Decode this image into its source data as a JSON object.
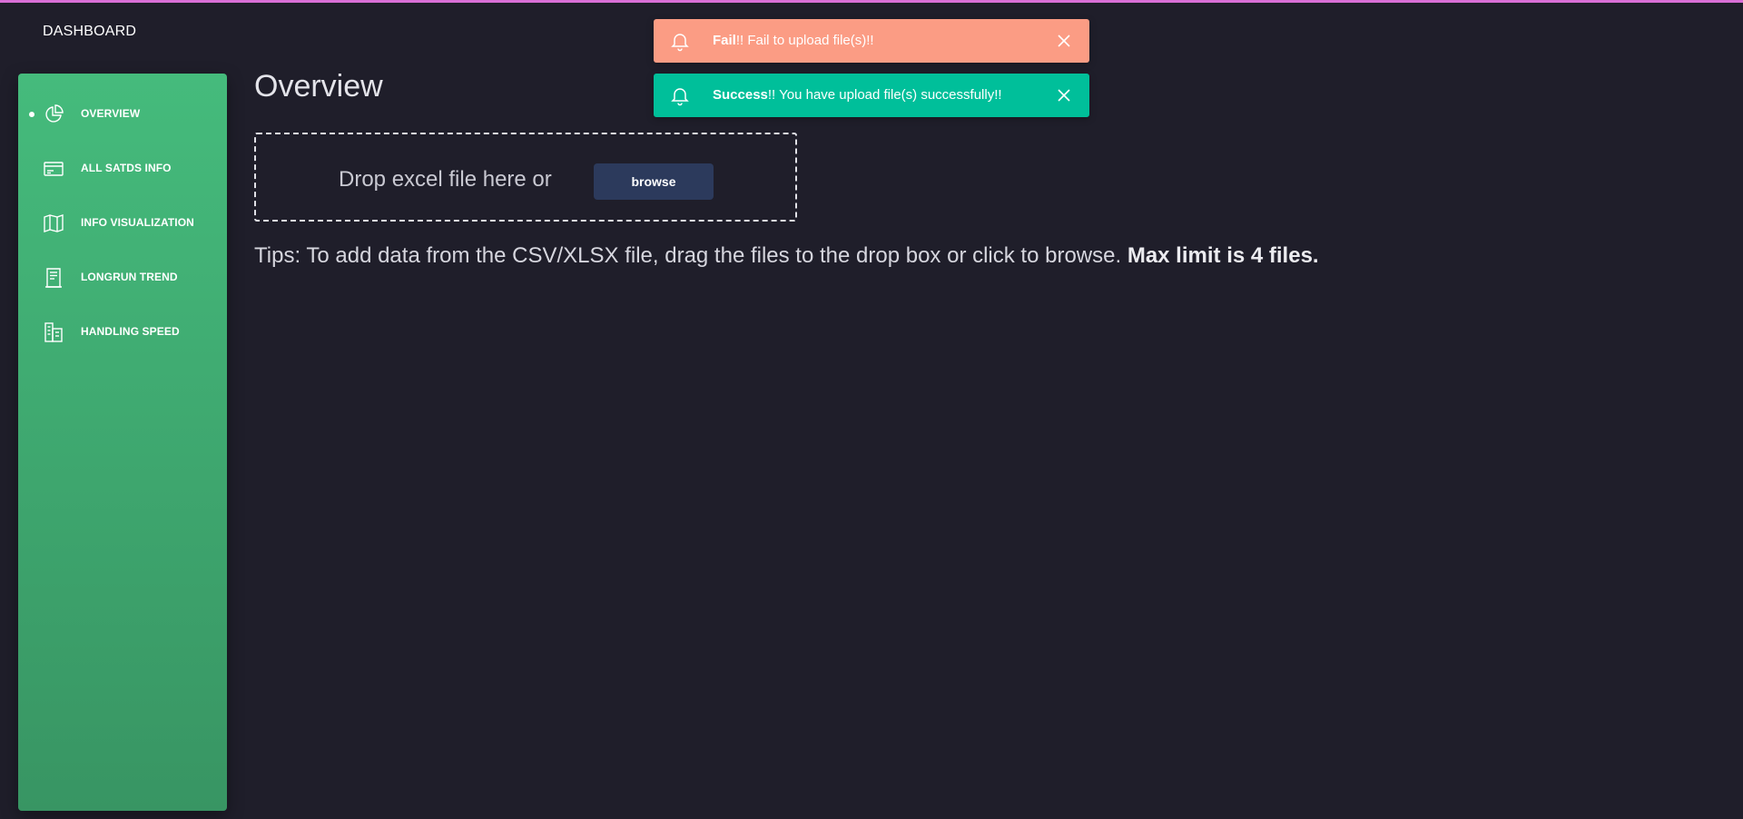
{
  "app": {
    "brand": "DASHBOARD",
    "accent_top_line": "#d96fd6",
    "background": "#1f1e2a"
  },
  "sidebar": {
    "gradient": [
      "#45bb7c",
      "#389563"
    ],
    "items": [
      {
        "label": "OVERVIEW",
        "icon": "chart-pie-icon",
        "active": true
      },
      {
        "label": "ALL SATDS INFO",
        "icon": "credit-card-icon",
        "active": false
      },
      {
        "label": "INFO VISUALIZATION",
        "icon": "map-icon",
        "active": false
      },
      {
        "label": "LONGRUN TREND",
        "icon": "document-icon",
        "active": false
      },
      {
        "label": "HANDLING SPEED",
        "icon": "building-icon",
        "active": false
      }
    ]
  },
  "main": {
    "title": "Overview",
    "drop_zone": {
      "text": "Drop excel file here or",
      "browse_label": "browse",
      "button_color": "#2c3a5c"
    },
    "tips": {
      "text": "Tips: To add data from the CSV/XLSX file, drag the files to the drop box or click to browse.",
      "bold": "Max limit is 4 files."
    }
  },
  "notifications": [
    {
      "type": "fail",
      "title": "Fail",
      "message": "!! Fail to upload file(s)!!",
      "color": "#fb9c84",
      "icon": "bell-icon"
    },
    {
      "type": "success",
      "title": "Success",
      "message": "!! You have upload file(s) successfully!!",
      "color": "#00bf9a",
      "icon": "bell-icon"
    }
  ]
}
